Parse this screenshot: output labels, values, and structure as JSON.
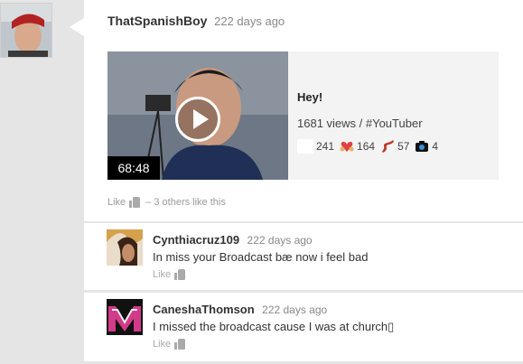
{
  "post": {
    "author": "ThatSpanishBoy",
    "time": "222 days ago",
    "video": {
      "duration": "68:48",
      "title": "Hey!",
      "meta": "1681 views / #YouTuber",
      "reactions": [
        {
          "icon": "blank-reaction-icon",
          "count": "241"
        },
        {
          "icon": "heart-hands-icon",
          "count": "164"
        },
        {
          "icon": "bacon-icon",
          "count": "57"
        },
        {
          "icon": "camera-icon",
          "count": "4"
        }
      ]
    },
    "like_label": "Like",
    "like_summary": "– 3 others like this"
  },
  "comments": [
    {
      "author": "Cynthiacruz109",
      "time": "222 days ago",
      "text": "In miss your Broadcast bæ now i feel bad",
      "like_label": "Like"
    },
    {
      "author": "CaneshaThomson",
      "time": "222 days ago",
      "text": "I missed the broadcast cause I was at church▯",
      "like_label": "Like"
    }
  ],
  "colors": {
    "background": "#e5e5e5",
    "card": "#ffffff",
    "accent_bacon": "#c0392b"
  }
}
